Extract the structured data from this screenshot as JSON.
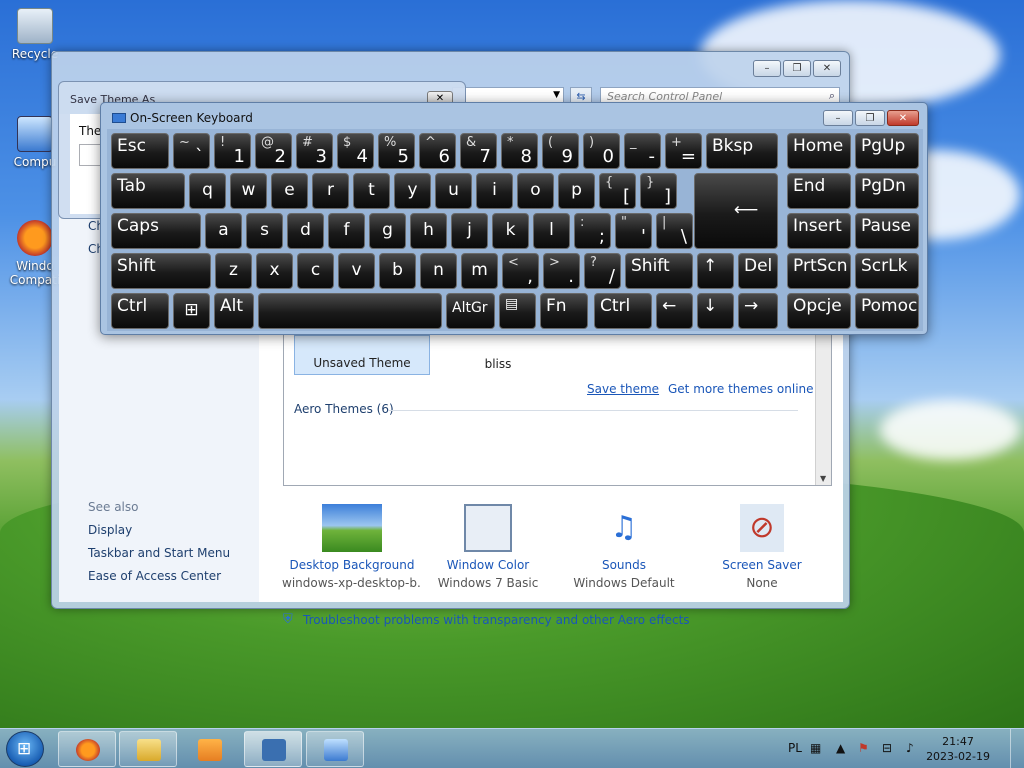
{
  "desktop": {
    "icons": [
      {
        "label": "Recycle"
      },
      {
        "label": "Compu"
      },
      {
        "label": "Windo Compati"
      }
    ]
  },
  "control_panel": {
    "search_placeholder": "Search Control Panel",
    "left_partial": [
      "Ch",
      "Ch"
    ],
    "see_also_label": "See also",
    "see_also_links": [
      "Display",
      "Taskbar and Start Menu",
      "Ease of Access Center"
    ],
    "themes": [
      {
        "label": "Unsaved Theme"
      },
      {
        "label": "bliss"
      }
    ],
    "save_theme_link": "Save theme",
    "get_more_link": "Get more themes online",
    "aero_header": "Aero Themes (6)",
    "bottom_items": [
      {
        "title": "Desktop Background",
        "sub": "windows-xp-desktop-b..."
      },
      {
        "title": "Window Color",
        "sub": "Windows 7 Basic"
      },
      {
        "title": "Sounds",
        "sub": "Windows Default"
      },
      {
        "title": "Screen Saver",
        "sub": "None"
      }
    ],
    "troubleshoot_link": "Troubleshoot problems with transparency and other Aero effects"
  },
  "save_dialog": {
    "title": "Save Theme As",
    "label": "Ther",
    "close_symbol": "✕"
  },
  "osk": {
    "title": "On-Screen Keyboard",
    "minimize_symbol": "–",
    "restore_symbol": "❐",
    "close_symbol": "✕"
  },
  "taskbar": {
    "language": "PL",
    "time": "21:47",
    "date": "2023-02-19"
  }
}
